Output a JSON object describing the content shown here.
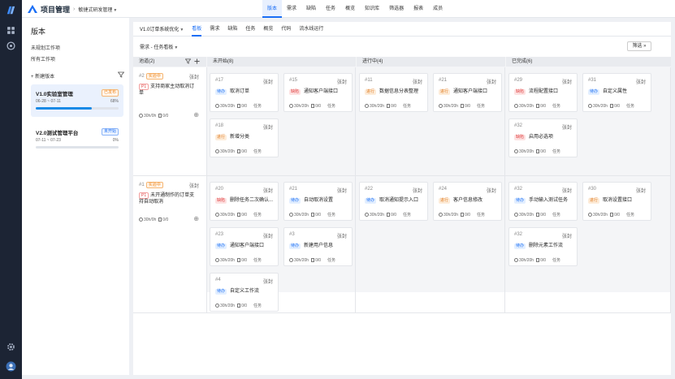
{
  "header": {
    "app_title": "项目管理",
    "project": "敏捷式研发管理",
    "nav": [
      "版本",
      "需求",
      "缺陷",
      "任务",
      "概览",
      "知识库",
      "筛选器",
      "报表",
      "成员"
    ],
    "active_nav": 0
  },
  "sidebar": {
    "title": "版本",
    "links": [
      "未规划工作项",
      "所有工作项"
    ],
    "new_version": "+ 新建版本",
    "versions": [
      {
        "name": "V1.0实验室管理",
        "badge": "已发布",
        "dates": "06-28 ~ 07-11",
        "percent": "68%",
        "progress": 0.68
      },
      {
        "name": "V2.0测试管理平台",
        "badge": "未开始",
        "dates": "07-11 ~ 07-23",
        "percent": "0%",
        "progress": 0
      }
    ]
  },
  "subnav": {
    "version_select": "V1.0订单系统优化",
    "tabs": [
      "看板",
      "需求",
      "缺陷",
      "任务",
      "概览",
      "代码",
      "流水线运行"
    ],
    "active_tab": 0
  },
  "toolbar": {
    "view_select": "需求 - 任务看板",
    "filter_label": "筛选"
  },
  "board": {
    "columns": [
      {
        "name": "池道(2)"
      },
      {
        "name": "未开始(8)"
      },
      {
        "name": "进行中(4)"
      },
      {
        "name": "已完成(6)"
      }
    ],
    "lanes": [
      {
        "req": {
          "id": "#2",
          "badge": "实验中",
          "owner": "张封",
          "tag": "P1",
          "title": "支持商家主动取消订单",
          "hours": "30h/0h",
          "files": "0/0"
        },
        "cards": {
          "todo": [
            {
              "id": "#17",
              "owner": "张封",
              "tag": "待办",
              "title": "取消订单",
              "hours": "30h/20h",
              "files": "0/0",
              "type": "任务"
            },
            {
              "id": "#15",
              "owner": "张封",
              "tag": "缺陷",
              "title": "通知客户端接口",
              "hours": "30h/20h",
              "files": "0/0",
              "type": "任务"
            },
            {
              "id": "#18",
              "owner": "张封",
              "tag": "进行",
              "title": "新增分类",
              "hours": "30h/20h",
              "files": "0/0",
              "type": "任务"
            }
          ],
          "prog": [
            {
              "id": "#11",
              "owner": "张封",
              "tag": "进行",
              "title": "数据信息分表整理",
              "hours": "30h/20h",
              "files": "0/0",
              "type": "任务"
            },
            {
              "id": "#21",
              "owner": "张封",
              "tag": "进行",
              "title": "通知客户端接口",
              "hours": "30h/20h",
              "files": "0/0",
              "type": "任务"
            }
          ],
          "done": [
            {
              "id": "#29",
              "owner": "张封",
              "tag": "缺陷",
              "title": "流程配置接口",
              "hours": "30h/20h",
              "files": "0/0",
              "type": "任务"
            },
            {
              "id": "#31",
              "owner": "张封",
              "tag": "待办",
              "title": "自定义属性",
              "hours": "30h/20h",
              "files": "0/0",
              "type": "任务"
            },
            {
              "id": "#32",
              "owner": "张封",
              "tag": "缺陷",
              "title": "启用必选项",
              "hours": "30h/20h",
              "files": "0/0",
              "type": "任务"
            }
          ]
        }
      },
      {
        "req": {
          "id": "#1",
          "badge": "实验中",
          "owner": "张封",
          "tag": "P1",
          "title": "未开通制作的订单支持自动取消",
          "hours": "30h/0h",
          "files": "0/0"
        },
        "cards": {
          "todo": [
            {
              "id": "#20",
              "owner": "张封",
              "tag": "缺陷",
              "title": "删除任务二次确认...",
              "hours": "30h/20h",
              "files": "0/0",
              "type": "任务"
            },
            {
              "id": "#21",
              "owner": "张封",
              "tag": "待办",
              "title": "自动取消设置",
              "hours": "30h/20h",
              "files": "0/0",
              "type": "任务"
            },
            {
              "id": "#23",
              "owner": "张封",
              "tag": "待办",
              "title": "通知客户端接口",
              "hours": "30h/20h",
              "files": "0/0",
              "type": "任务"
            },
            {
              "id": "#3",
              "owner": "张封",
              "tag": "待办",
              "title": "新建用户信息",
              "hours": "30h/20h",
              "files": "0/0",
              "type": "任务"
            },
            {
              "id": "#4",
              "owner": "张封",
              "tag": "待办",
              "title": "自定义工作流",
              "hours": "30h/20h",
              "files": "0/0",
              "type": "任务"
            }
          ],
          "prog": [
            {
              "id": "#22",
              "owner": "张封",
              "tag": "待办",
              "title": "取消通知提示入口",
              "hours": "30h/20h",
              "files": "0/0",
              "type": "任务"
            },
            {
              "id": "#24",
              "owner": "张封",
              "tag": "进行",
              "title": "客户信息修改",
              "hours": "30h/20h",
              "files": "0/0",
              "type": "任务"
            }
          ],
          "done": [
            {
              "id": "#32",
              "owner": "张封",
              "tag": "待办",
              "title": "手动输入测试任务",
              "hours": "30h/20h",
              "files": "0/0",
              "type": "任务"
            },
            {
              "id": "#30",
              "owner": "张封",
              "tag": "进行",
              "title": "取消设置接口",
              "hours": "30h/20h",
              "files": "0/0",
              "type": "任务"
            },
            {
              "id": "#32",
              "owner": "张封",
              "tag": "待办",
              "title": "删除元素工作流",
              "hours": "30h/20h",
              "files": "0/0",
              "type": "任务"
            }
          ]
        }
      }
    ]
  },
  "colors": {
    "accent": "#1a6ef5",
    "rail": "#1c2434",
    "board_bg": "#f4f5f7"
  }
}
